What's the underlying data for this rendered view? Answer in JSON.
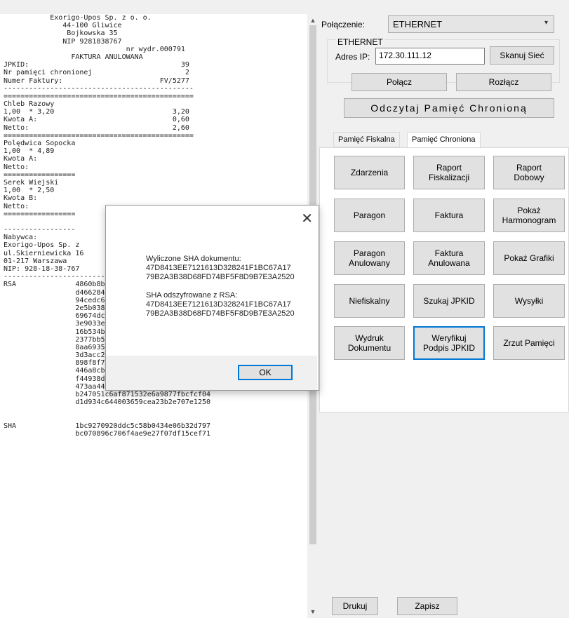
{
  "receipt": {
    "lines": [
      "           Exorigo-Upos Sp. z o. o.",
      "              44-100 Gliwice",
      "               Bojkowska 35",
      "              NIP 9281838767",
      "                             nr wydr.000791",
      "                FAKTURA ANULOWANA",
      "JPKID:                                    39",
      "Nr pamięci chronionej                      2",
      "Numer Faktury:                       FV/5277",
      "---------------------------------------------",
      "=============================================",
      "Chleb Razowy",
      "1,00  * 3,20                            3,20",
      "Kwota A:                                0,60",
      "Netto:                                  2,60",
      "=============================================",
      "Polędwica Sopocka",
      "1,00  * 4,89",
      "Kwota A:",
      "Netto:",
      "=================",
      "Serek Wiejski",
      "1,00  * 2,50",
      "Kwota B:",
      "Netto:",
      "=================",
      "",
      "-----------------",
      "Nabywca:",
      "Exorigo-Upos Sp. z",
      "ul.Skierniewicka 16",
      "01-217 Warszawa",
      "NIP: 928-18-38-767",
      "---------------------------------------------",
      "RSA              4860b8b52fa8efc9321ccbcc2e7644ba",
      "                 d4662841bd1a5eb215f0413c65c05b63",
      "                 94cedc6af1ce5a8dd6380fdcfb0d2c9b",
      "                 2e5b03855eac748a9faefdfd1af9a6ba",
      "                 69674dc817d412e02a83e4d399dcb918",
      "                 3e9033e6c13ff99f05d83213c4aa9f81",
      "                 16b534b198f6bde02e16d18f91045dbf",
      "                 2377bb5abce595056b62c17b804f8e1c",
      "                 8aa6935646d0d82622d4d8f125f4e371",
      "                 3d3acc25fd2fe21ee2fc33f17839f124",
      "                 898f8f7c3b6f4f50c82f928edfa513b8",
      "                 446a8cbd1dd0aecdc52fc123a1c236f1",
      "                 f44938dbf849712231243e3c3524638c",
      "                 473aa44558cea66afe5874b200c5585b",
      "                 b247051c6af871532e6a9877fbcfcf04",
      "                 d1d934c644003659cea23b2e707e1250",
      "",
      "",
      "SHA              1bc9270920ddc5c58b0434e06b32d797",
      "                 bc070896c706f4ae9e27f07df15cef71"
    ]
  },
  "connection": {
    "label": "Połączenie:",
    "selected": "ETHERNET",
    "group_title": "ETHERNET",
    "ip_label": "Adres IP:",
    "ip_value": "172.30.111.12",
    "scan_button": "Skanuj Sieć",
    "connect_button": "Połącz",
    "disconnect_button": "Rozłącz",
    "read_button": "Odczytaj Pamięć Chronioną"
  },
  "tabs": [
    "Pamięć Fiskalna",
    "Pamięć Chroniona"
  ],
  "buttons": [
    [
      "Zdarzenia",
      "Raport\nFiskalizacji",
      "Raport\nDobowy"
    ],
    [
      "Paragon",
      "Faktura",
      "Pokaż\nHarmonogram"
    ],
    [
      "Paragon\nAnulowany",
      "Faktura\nAnulowana",
      "Pokaż Grafiki"
    ],
    [
      "Niefiskalny",
      "Szukaj JPKID",
      "Wysyłki"
    ],
    [
      "Wydruk\nDokumentu",
      "Weryfikuj\nPodpis JPKID",
      "Zrzut Pamięci"
    ]
  ],
  "bottom": {
    "print": "Drukuj",
    "save": "Zapisz"
  },
  "dialog": {
    "line1": "Wyliczone SHA dokumentu:",
    "sha1a": "47D8413EE7121613D328241F1BC67A17",
    "sha1b": "79B2A3B38D68FD74BF5F8D9B7E3A2520",
    "line2": "SHA odszyfrowane z RSA:",
    "sha2a": "47D8413EE7121613D328241F1BC67A17",
    "sha2b": "79B2A3B38D68FD74BF5F8D9B7E3A2520",
    "ok": "OK"
  }
}
